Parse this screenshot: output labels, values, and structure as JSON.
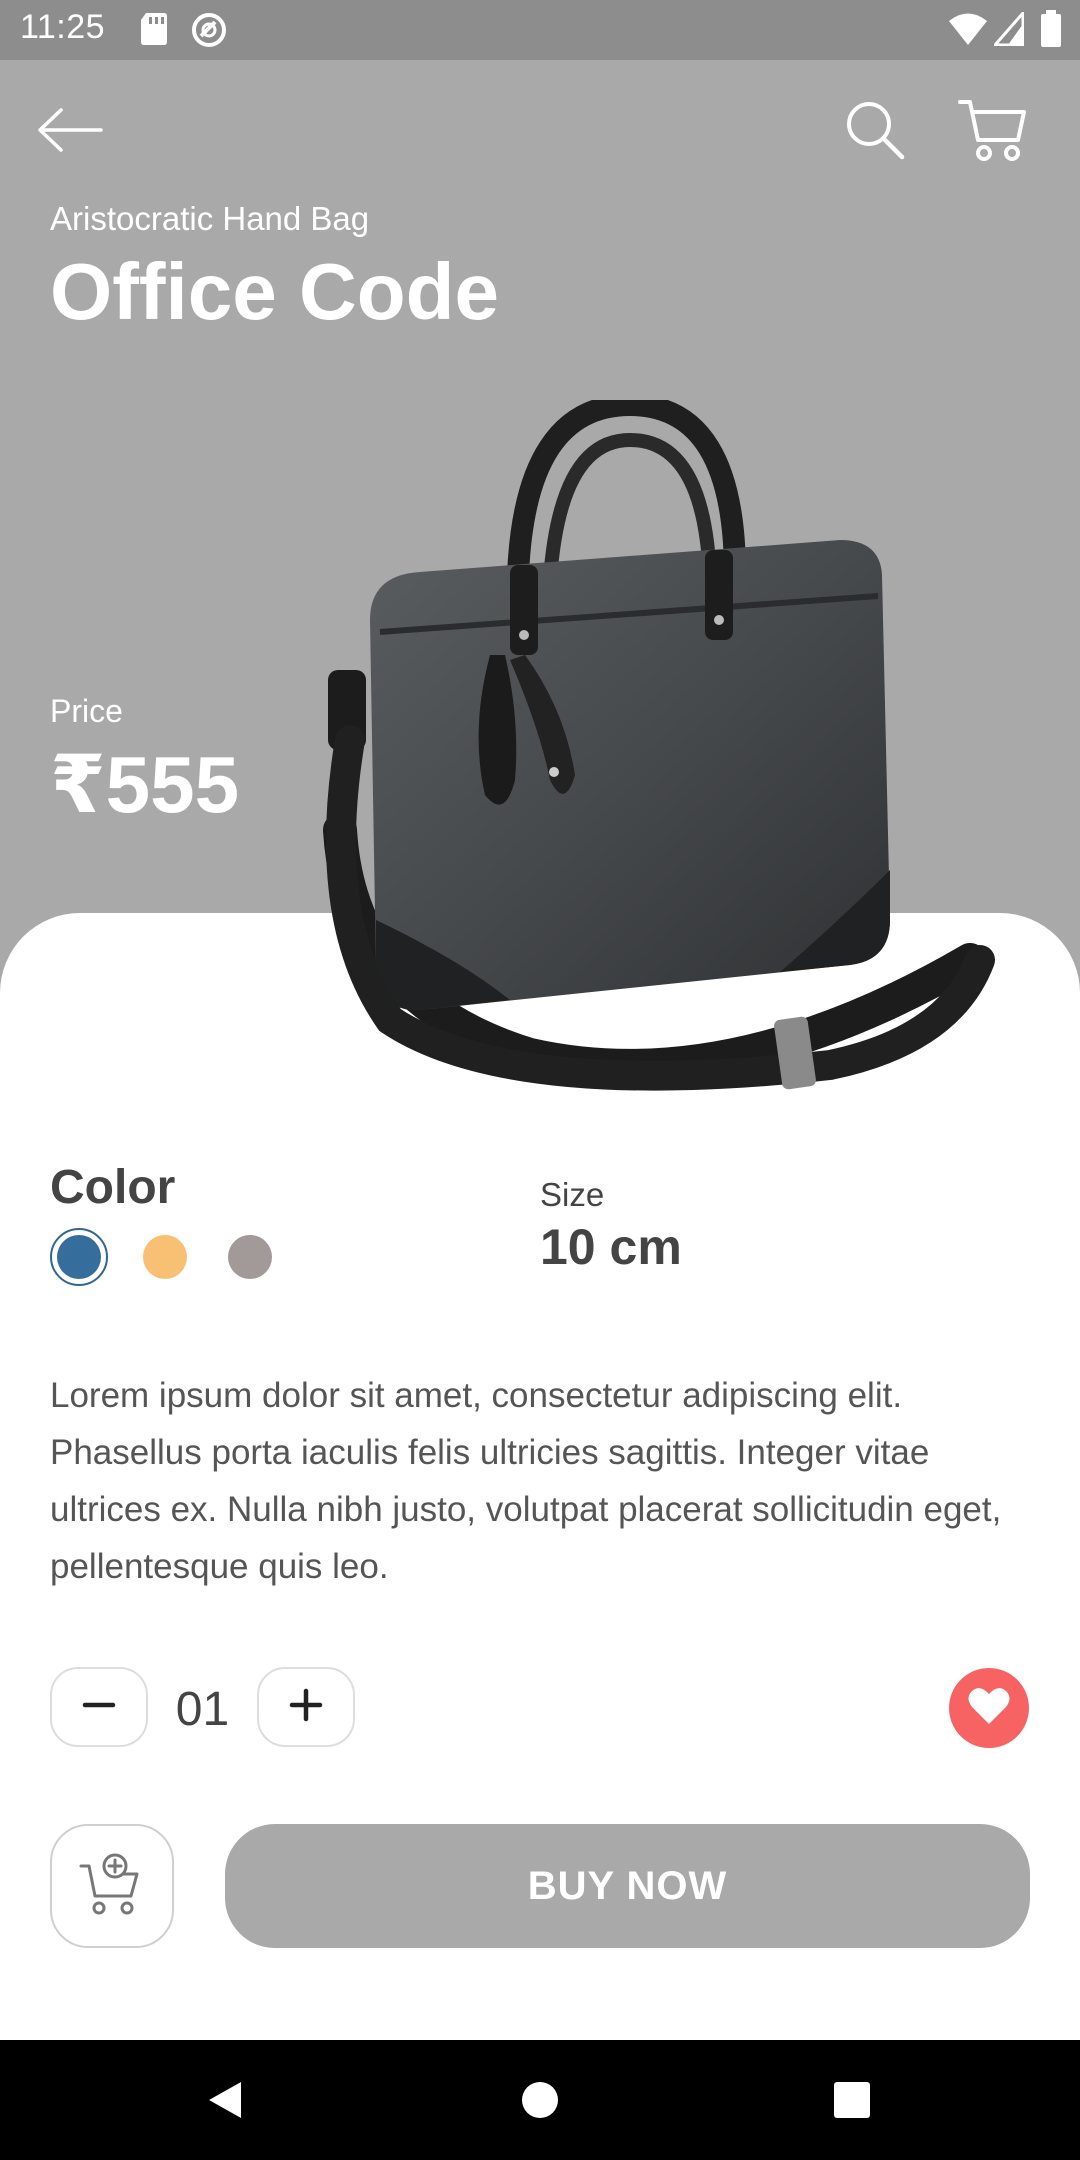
{
  "status": {
    "time": "11:25",
    "icons": [
      "sd-card-icon",
      "sync-icon",
      "wifi-icon",
      "signal-icon",
      "battery-icon"
    ]
  },
  "header": {
    "back_icon": "arrow-left-icon",
    "search_icon": "search-icon",
    "cart_icon": "cart-icon"
  },
  "product": {
    "subtitle": "Aristocratic Hand Bag",
    "title": "Office Code",
    "price_label": "Price",
    "price": "₹555",
    "color_label": "Color",
    "colors": [
      "#356d9c",
      "#f7c073",
      "#a29a99"
    ],
    "selected_color_index": 0,
    "size_label": "Size",
    "size_value": "10 cm",
    "description": "Lorem ipsum dolor sit amet, consectetur adipiscing elit. Phasellus porta iaculis felis ultricies sagittis. Integer vitae ultrices ex. Nulla nibh justo, volutpat placerat sollicitudin eget, pellentesque quis leo."
  },
  "quantity": {
    "value": "01",
    "decrement_icon": "minus-icon",
    "increment_icon": "plus-icon"
  },
  "actions": {
    "favorite_icon": "heart-icon",
    "add_to_cart_icon": "cart-plus-icon",
    "buy_label": "BUY NOW"
  },
  "colors": {
    "hero_bg": "#a9a9a9",
    "favorite": "#f76262",
    "buy_button": "#a9a9a9"
  }
}
